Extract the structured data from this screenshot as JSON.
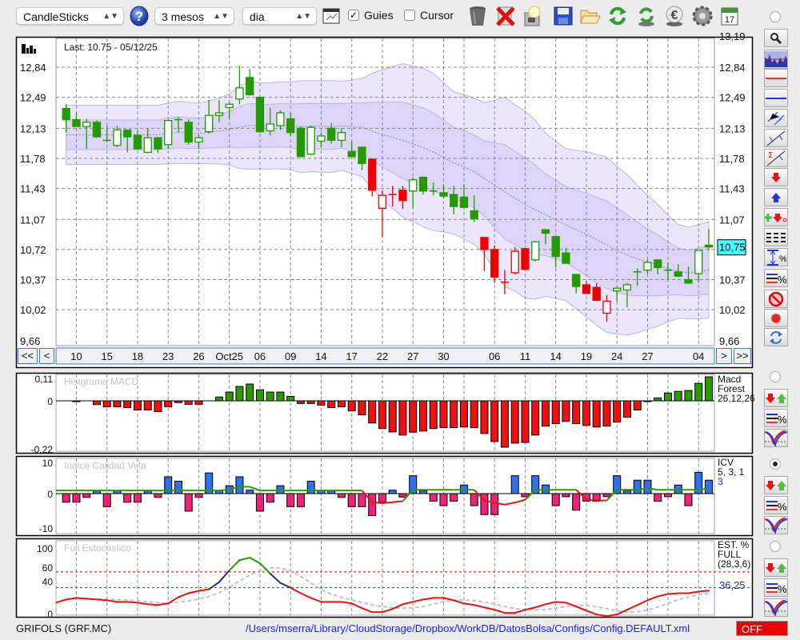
{
  "toolbar": {
    "chart_type": "CandleSticks",
    "period": "3 mesos",
    "interval": "dia",
    "guides_label": "Guies",
    "guides_checked": true,
    "cursor_label": "Cursor",
    "cursor_checked": false,
    "check_mark": "✓",
    "icons": [
      "help-icon",
      "chart-settings-icon",
      "trash-icon",
      "delete-icon",
      "lightbulb-icon",
      "save-icon",
      "folder-open-icon",
      "refresh-icon",
      "refresh-currency-icon",
      "euro-icon",
      "gear-icon",
      "calendar-icon"
    ],
    "calendar_day": "17"
  },
  "main_chart": {
    "last_label": "Last: 10.75 - 05/12/25",
    "last_price_label": "10,75",
    "last_price": 10.75,
    "top_cut_label": "13,19",
    "price_labels": [
      "12,84",
      "12,49",
      "12,13",
      "11,78",
      "11,43",
      "11,07",
      "10,72",
      "10,37",
      "10,02",
      "9,66"
    ],
    "price_values": [
      12.84,
      12.49,
      12.13,
      11.78,
      11.43,
      11.07,
      10.72,
      10.37,
      10.02,
      9.66
    ],
    "nav": {
      "first": "<<",
      "prev": "<",
      "next": ">",
      "last": ">>"
    },
    "date_labels": [
      {
        "i": 1,
        "t": "10"
      },
      {
        "i": 4,
        "t": "15"
      },
      {
        "i": 7,
        "t": "18"
      },
      {
        "i": 10,
        "t": "23"
      },
      {
        "i": 13,
        "t": "26"
      },
      {
        "i": 16,
        "t": "Oct25"
      },
      {
        "i": 19,
        "t": "06"
      },
      {
        "i": 22,
        "t": "09"
      },
      {
        "i": 25,
        "t": "14"
      },
      {
        "i": 28,
        "t": "17"
      },
      {
        "i": 31,
        "t": "22"
      },
      {
        "i": 34,
        "t": "27"
      },
      {
        "i": 37,
        "t": "30"
      },
      {
        "i": 42,
        "t": "06"
      },
      {
        "i": 45,
        "t": "11"
      },
      {
        "i": 48,
        "t": "14"
      },
      {
        "i": 51,
        "t": "19"
      },
      {
        "i": 54,
        "t": "24"
      },
      {
        "i": 57,
        "t": "27"
      },
      {
        "i": 62,
        "t": "04"
      }
    ],
    "grid_indices": [
      1,
      4,
      7,
      10,
      13,
      16,
      19,
      22,
      25,
      28,
      31,
      34,
      37,
      39,
      42,
      45,
      48,
      51,
      54,
      57,
      59,
      62
    ],
    "colors": {
      "up": "#229a00",
      "down": "#ee0000",
      "band_outer": "#ebe6fc",
      "band_inner": "#ddd5f8",
      "band_line": "#bdb4e4",
      "ma_line": "#8a86a0"
    }
  },
  "chart_data": [
    {
      "type": "candlestick",
      "title": "GRIFOLS (GRF.MC)",
      "ylim": [
        9.66,
        13.19
      ],
      "ohlc": [
        [
          12.36,
          12.41,
          12.08,
          12.23
        ],
        [
          12.23,
          12.31,
          12.15,
          12.15
        ],
        [
          12.15,
          12.24,
          11.89,
          12.2
        ],
        [
          12.2,
          12.22,
          12.02,
          12.03
        ],
        [
          11.99,
          12.16,
          11.97,
          11.99
        ],
        [
          11.93,
          12.16,
          11.91,
          12.11
        ],
        [
          12.11,
          12.11,
          11.85,
          12.03
        ],
        [
          12.05,
          12.1,
          11.88,
          11.89
        ],
        [
          11.85,
          12.13,
          11.84,
          12.02
        ],
        [
          12.02,
          12.03,
          11.84,
          11.89
        ],
        [
          11.94,
          12.23,
          11.89,
          12.22
        ],
        [
          12.23,
          12.26,
          12.08,
          12.23
        ],
        [
          12.2,
          12.23,
          11.94,
          11.97
        ],
        [
          11.97,
          12.05,
          11.89,
          12.02
        ],
        [
          12.09,
          12.46,
          12.07,
          12.28
        ],
        [
          12.28,
          12.46,
          12.2,
          12.31
        ],
        [
          12.37,
          12.43,
          12.24,
          12.41
        ],
        [
          12.47,
          12.86,
          12.41,
          12.6
        ],
        [
          12.72,
          12.82,
          12.51,
          12.52
        ],
        [
          12.49,
          12.5,
          12.08,
          12.09
        ],
        [
          12.1,
          12.37,
          12.05,
          12.18
        ],
        [
          12.16,
          12.34,
          12.11,
          12.31
        ],
        [
          12.24,
          12.31,
          12.04,
          12.08
        ],
        [
          12.13,
          12.15,
          11.79,
          11.8
        ],
        [
          11.83,
          12.16,
          11.82,
          12.14
        ],
        [
          11.98,
          12.08,
          11.91,
          12.04
        ],
        [
          12.13,
          12.19,
          11.95,
          11.99
        ],
        [
          11.99,
          12.13,
          11.91,
          12.08
        ],
        [
          11.86,
          11.98,
          11.79,
          11.8
        ],
        [
          11.91,
          11.91,
          11.64,
          11.72
        ],
        [
          11.77,
          11.77,
          11.34,
          11.41
        ],
        [
          11.2,
          11.4,
          10.86,
          11.35
        ],
        [
          11.36,
          11.46,
          11.22,
          11.36
        ],
        [
          11.41,
          11.46,
          11.19,
          11.29
        ],
        [
          11.4,
          11.56,
          11.2,
          11.53
        ],
        [
          11.56,
          11.57,
          11.36,
          11.4
        ],
        [
          11.4,
          11.5,
          11.35,
          11.4
        ],
        [
          11.38,
          11.47,
          11.31,
          11.34
        ],
        [
          11.36,
          11.46,
          11.13,
          11.22
        ],
        [
          11.33,
          11.48,
          11.21,
          11.21
        ],
        [
          11.17,
          11.35,
          11.04,
          11.08
        ],
        [
          10.86,
          10.86,
          10.47,
          10.72
        ],
        [
          10.72,
          10.77,
          10.33,
          10.4
        ],
        [
          10.34,
          10.48,
          10.2,
          10.34
        ],
        [
          10.45,
          10.75,
          10.43,
          10.7
        ],
        [
          10.73,
          10.73,
          10.48,
          10.49
        ],
        [
          10.6,
          10.82,
          10.58,
          10.81
        ],
        [
          10.95,
          10.96,
          10.78,
          10.91
        ],
        [
          10.87,
          10.87,
          10.51,
          10.64
        ],
        [
          10.68,
          10.74,
          10.56,
          10.56
        ],
        [
          10.43,
          10.43,
          10.21,
          10.29
        ],
        [
          10.31,
          10.35,
          10.21,
          10.21
        ],
        [
          10.28,
          10.33,
          10.12,
          10.13
        ],
        [
          9.98,
          10.19,
          9.88,
          10.12
        ],
        [
          10.24,
          10.28,
          10.11,
          10.27
        ],
        [
          10.25,
          10.33,
          10.05,
          10.31
        ],
        [
          10.46,
          10.5,
          10.3,
          10.46
        ],
        [
          10.48,
          10.6,
          10.44,
          10.57
        ],
        [
          10.6,
          10.6,
          10.43,
          10.51
        ],
        [
          10.48,
          10.57,
          10.37,
          10.48
        ],
        [
          10.46,
          10.55,
          10.4,
          10.41
        ],
        [
          10.37,
          10.52,
          10.32,
          10.33
        ],
        [
          10.44,
          10.71,
          10.34,
          10.71
        ],
        [
          10.77,
          10.96,
          10.71,
          10.75
        ]
      ],
      "candle_colors": "ggggggggggggggggggggggggggggggrrrrgggggggrrrrrgggggrrrgggggggggg"
    },
    {
      "type": "bar",
      "title": "Histgrama MACD",
      "legend": [
        "Macd",
        "Forest",
        "26,12,26"
      ],
      "tick_labels": [
        {
          "v": 0.11,
          "t": "0,11"
        },
        {
          "v": 0,
          "t": "0"
        },
        {
          "v": -0.22,
          "t": "-0,22"
        }
      ],
      "ylim": [
        -0.22,
        0.11
      ],
      "values": [
        0,
        -0.004,
        0,
        -0.017,
        -0.027,
        -0.027,
        -0.03,
        -0.041,
        -0.041,
        -0.048,
        -0.027,
        -0.008,
        -0.016,
        -0.016,
        0,
        0.017,
        0.039,
        0.064,
        0.075,
        0.049,
        0.039,
        0.039,
        0.02,
        -0.012,
        -0.012,
        -0.02,
        -0.03,
        -0.027,
        -0.045,
        -0.063,
        -0.099,
        -0.124,
        -0.139,
        -0.153,
        -0.14,
        -0.135,
        -0.124,
        -0.12,
        -0.12,
        -0.117,
        -0.12,
        -0.146,
        -0.182,
        -0.207,
        -0.189,
        -0.186,
        -0.153,
        -0.113,
        -0.102,
        -0.092,
        -0.102,
        -0.11,
        -0.117,
        -0.113,
        -0.095,
        -0.073,
        -0.041,
        -0.004,
        0.013,
        0.035,
        0.042,
        0.046,
        0.078,
        0.107
      ],
      "colors": {
        "pos": "#2a9a00",
        "neg": "#ee1111"
      }
    },
    {
      "type": "bar",
      "title": "Indice Calidad Vela",
      "legend": [
        "ICV",
        "5, 3, 1"
      ],
      "legend_value": "3",
      "tick_labels": [
        {
          "v": 10,
          "t": "10"
        },
        {
          "v": 0,
          "t": "0"
        },
        {
          "v": -10,
          "t": "-10"
        }
      ],
      "ylim": [
        -10,
        10
      ],
      "values": [
        -2.5,
        -2.5,
        -1.1,
        0.9,
        -3.8,
        0.9,
        -2.5,
        -2.5,
        0.9,
        -1.1,
        4.9,
        3.6,
        -5.1,
        -1.1,
        6,
        0.9,
        2.3,
        4.9,
        1,
        -5.1,
        -2.5,
        2.3,
        -3.8,
        -3.8,
        3.6,
        0.9,
        0.9,
        -1.1,
        -3.8,
        -3.8,
        -6.4,
        -2.5,
        1,
        -1,
        5.2,
        0.9,
        -2.2,
        -3.5,
        -2.2,
        2.5,
        -3.5,
        -6.1,
        -6.1,
        0,
        5.2,
        -0.9,
        5.2,
        2.5,
        -3.5,
        -0.9,
        -4.8,
        -2.2,
        -2.2,
        -0.9,
        5.2,
        0.9,
        3.9,
        3.9,
        -2.2,
        -0.9,
        2.5,
        -3.5,
        6.2,
        3.9
      ],
      "signal": [
        0.9,
        0.9,
        0.9,
        0.9,
        0.9,
        0.9,
        0.9,
        0.9,
        0.9,
        0.9,
        0.9,
        0.9,
        0.9,
        0.9,
        0.9,
        0.9,
        1.2,
        2,
        2,
        0.9,
        0.9,
        0.9,
        0.9,
        0.9,
        0.9,
        0.9,
        0.9,
        0.9,
        0.9,
        0.9,
        -2.5,
        -2.8,
        -2.5,
        -2.2,
        1.1,
        1.1,
        1.1,
        1.1,
        1.1,
        1.1,
        1.1,
        -2,
        -2.7,
        -3.2,
        -2.6,
        -1.8,
        1.1,
        1.1,
        1.1,
        1.1,
        1.1,
        -1.7,
        -2,
        -2,
        1.1,
        1.1,
        1.1,
        1.6,
        1.1,
        1.1,
        1.1,
        1.1,
        1.1,
        1.5
      ],
      "colors": {
        "pos": "#2f6ff0",
        "neg": "#ee2277",
        "signal_up": "#2a9a00",
        "signal_down": "#ee1111"
      }
    },
    {
      "type": "line",
      "title": "Full Estocastico",
      "legend": [
        "EST. %",
        "FULL",
        "(28,3,6)"
      ],
      "legend_value": "36,25",
      "tick_labels": [
        {
          "v": 100,
          "t": "100"
        },
        {
          "v": 60,
          "t": "60"
        },
        {
          "v": 40,
          "t": "40"
        },
        {
          "v": 0,
          "t": "0"
        }
      ],
      "levels": [
        60,
        40
      ],
      "ylim": [
        0,
        100
      ],
      "k": [
        25,
        27,
        26,
        25,
        24,
        22,
        22,
        21,
        19,
        18,
        20,
        28,
        33,
        36,
        38,
        47,
        62,
        75,
        78,
        71,
        58,
        46,
        40,
        33,
        27,
        22,
        22,
        22,
        20,
        14,
        9,
        9,
        13,
        19,
        22,
        25,
        27,
        27,
        24,
        20,
        18,
        15,
        12,
        8,
        8,
        12,
        15,
        19,
        22,
        21,
        16,
        11,
        6,
        4,
        6,
        12,
        18,
        24,
        29,
        32,
        33,
        33,
        35,
        36.25
      ],
      "colors": {
        "high": "#2a9a00",
        "mid": "#2a2a8a",
        "low": "#ee1111",
        "d": "#c4c4c4",
        "level_high": "#dd0000",
        "level_low": "#117711"
      }
    }
  ],
  "footer": {
    "symbol": "GRIFOLS (GRF.MC)",
    "path": "/Users/mserra/Library/CloudStorage/Dropbox/WorkDB/DatosBolsa/Configs/Config.DEFAULT.xml",
    "off_label": "OFF"
  },
  "right_tools": [
    "zoom-icon",
    "chart-thumbnail-icon",
    "red-line-icon",
    "blue-line-icon",
    "channel-icon",
    "trendline-icon",
    "sigma-trendline-icon",
    "sell-arrow-icon",
    "buy-arrow-icon",
    "add-signal-icon",
    "dashes-icon",
    "range-percent-icon",
    "lines-percent-icon",
    "no-entry-icon",
    "record-icon",
    "swap-icon"
  ],
  "panel_tools": [
    "signals-icon",
    "lines-percent-icon",
    "curve-icon"
  ]
}
